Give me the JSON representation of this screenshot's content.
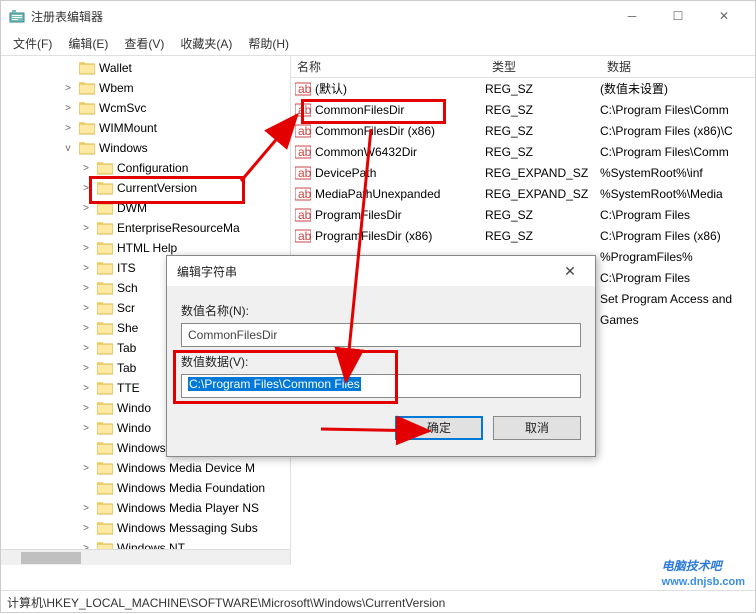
{
  "window": {
    "title": "注册表编辑器"
  },
  "menu": {
    "file": "文件(F)",
    "edit": "编辑(E)",
    "view": "查看(V)",
    "favorites": "收藏夹(A)",
    "help": "帮助(H)"
  },
  "columns": {
    "name": "名称",
    "type": "类型",
    "data": "数据"
  },
  "tree": [
    {
      "indent": 3,
      "expand": "",
      "label": "Wallet"
    },
    {
      "indent": 3,
      "expand": ">",
      "label": "Wbem"
    },
    {
      "indent": 3,
      "expand": ">",
      "label": "WcmSvc"
    },
    {
      "indent": 3,
      "expand": ">",
      "label": "WIMMount"
    },
    {
      "indent": 3,
      "expand": "v",
      "label": "Windows"
    },
    {
      "indent": 4,
      "expand": ">",
      "label": "Configuration"
    },
    {
      "indent": 4,
      "expand": ">",
      "label": "CurrentVersion",
      "highlight": true
    },
    {
      "indent": 4,
      "expand": ">",
      "label": "DWM"
    },
    {
      "indent": 4,
      "expand": ">",
      "label": "EnterpriseResourceMa"
    },
    {
      "indent": 4,
      "expand": ">",
      "label": "HTML Help"
    },
    {
      "indent": 4,
      "expand": ">",
      "label": "ITS"
    },
    {
      "indent": 4,
      "expand": ">",
      "label": "Sch"
    },
    {
      "indent": 4,
      "expand": ">",
      "label": "Scr"
    },
    {
      "indent": 4,
      "expand": ">",
      "label": "She"
    },
    {
      "indent": 4,
      "expand": ">",
      "label": "Tab"
    },
    {
      "indent": 4,
      "expand": ">",
      "label": "Tab"
    },
    {
      "indent": 4,
      "expand": ">",
      "label": "TTE"
    },
    {
      "indent": 4,
      "expand": ">",
      "label": "Windo"
    },
    {
      "indent": 4,
      "expand": ">",
      "label": "Windo"
    },
    {
      "indent": 4,
      "expand": "",
      "label": "Windows Mail"
    },
    {
      "indent": 4,
      "expand": ">",
      "label": "Windows Media Device M"
    },
    {
      "indent": 4,
      "expand": "",
      "label": "Windows Media Foundation"
    },
    {
      "indent": 4,
      "expand": ">",
      "label": "Windows Media Player NS"
    },
    {
      "indent": 4,
      "expand": ">",
      "label": "Windows Messaging Subs"
    },
    {
      "indent": 4,
      "expand": ">",
      "label": "Windows NT"
    }
  ],
  "list": [
    {
      "icon": "ab",
      "name": "(默认)",
      "type": "REG_SZ",
      "data": "(数值未设置)"
    },
    {
      "icon": "ab",
      "name": "CommonFilesDir",
      "type": "REG_SZ",
      "data": "C:\\Program Files\\Comm",
      "highlight": true
    },
    {
      "icon": "ab",
      "name": "CommonFilesDir (x86)",
      "type": "REG_SZ",
      "data": "C:\\Program Files (x86)\\C"
    },
    {
      "icon": "ab",
      "name": "CommonW6432Dir",
      "type": "REG_SZ",
      "data": "C:\\Program Files\\Comm"
    },
    {
      "icon": "ab",
      "name": "DevicePath",
      "type": "REG_EXPAND_SZ",
      "data": "%SystemRoot%\\inf"
    },
    {
      "icon": "ab",
      "name": "MediaPathUnexpanded",
      "type": "REG_EXPAND_SZ",
      "data": "%SystemRoot%\\Media"
    },
    {
      "icon": "ab",
      "name": "ProgramFilesDir",
      "type": "REG_SZ",
      "data": "C:\\Program Files"
    },
    {
      "icon": "ab",
      "name": "ProgramFilesDir (x86)",
      "type": "REG_SZ",
      "data": "C:\\Program Files (x86)"
    },
    {
      "icon": "ab",
      "name": "",
      "type": "",
      "data": "%ProgramFiles%"
    },
    {
      "icon": "ab",
      "name": "",
      "type": "",
      "data": "C:\\Program Files"
    },
    {
      "icon": "ab",
      "name": "",
      "type": "",
      "data": "Set Program Access and"
    },
    {
      "icon": "ab",
      "name": "",
      "type": "",
      "data": "Games"
    }
  ],
  "dialog": {
    "title": "编辑字符串",
    "name_label": "数值名称(N):",
    "name_value": "CommonFilesDir",
    "data_label": "数值数据(V):",
    "data_value": "C:\\Program Files\\Common Files",
    "ok": "确定",
    "cancel": "取消"
  },
  "statusbar": "计算机\\HKEY_LOCAL_MACHINE\\SOFTWARE\\Microsoft\\Windows\\CurrentVersion",
  "watermark": {
    "text": "电脑技术吧",
    "url": "www.dnjsb.com"
  }
}
